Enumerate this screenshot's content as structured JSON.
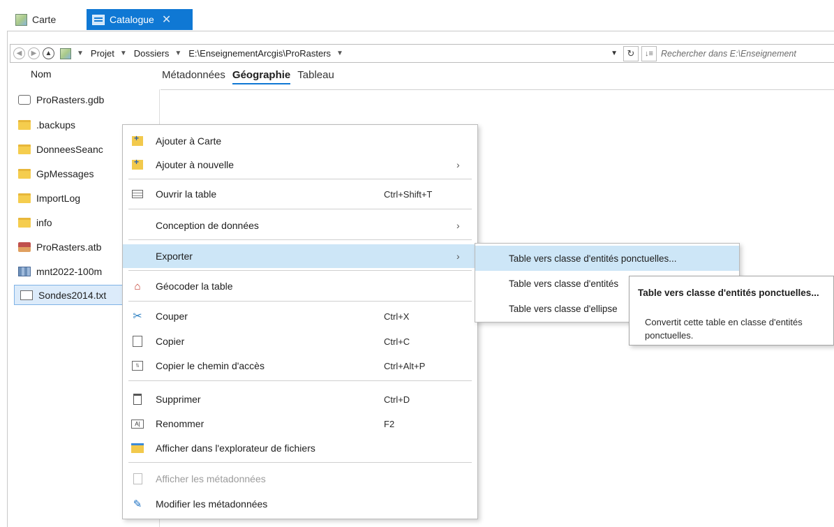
{
  "tabs": [
    {
      "label": "Carte",
      "icon": "map-icon"
    },
    {
      "label": "Catalogue",
      "icon": "catalog-icon",
      "active": true,
      "close": "✕"
    }
  ],
  "address": {
    "crumbs": [
      "Projet",
      "Dossiers",
      "E:\\EnseignementArcgis\\ProRasters"
    ],
    "search_placeholder": "Rechercher dans E:\\Enseignement"
  },
  "contents": {
    "header": "Nom",
    "items": [
      {
        "label": "ProRasters.gdb",
        "icon": "geodatabase-icon"
      },
      {
        "label": ".backups",
        "icon": "folder-icon"
      },
      {
        "label": "DonneesSeanc",
        "icon": "folder-icon"
      },
      {
        "label": "GpMessages",
        "icon": "folder-icon"
      },
      {
        "label": "ImportLog",
        "icon": "folder-icon"
      },
      {
        "label": "info",
        "icon": "folder-icon"
      },
      {
        "label": "ProRasters.atb",
        "icon": "toolbox-icon"
      },
      {
        "label": "mnt2022-100m",
        "icon": "raster-icon"
      },
      {
        "label": "Sondes2014.txt",
        "icon": "text-file-icon",
        "selected": true
      }
    ]
  },
  "view_tabs": [
    "Métadonnées",
    "Géographie",
    "Tableau"
  ],
  "context_menu": {
    "items": [
      {
        "label": "Ajouter à Carte",
        "shortcut": "",
        "submenu": false
      },
      {
        "label": "Ajouter à nouvelle",
        "shortcut": "",
        "submenu": true
      },
      {
        "label": "Ouvrir la table",
        "shortcut": "Ctrl+Shift+T",
        "submenu": false
      },
      {
        "label": "Conception de données",
        "shortcut": "",
        "submenu": true
      },
      {
        "label": "Exporter",
        "shortcut": "",
        "submenu": true,
        "highlighted": true
      },
      {
        "label": "Géocoder la table",
        "shortcut": "",
        "submenu": false
      },
      {
        "label": "Couper",
        "shortcut": "Ctrl+X",
        "submenu": false
      },
      {
        "label": "Copier",
        "shortcut": "Ctrl+C",
        "submenu": false
      },
      {
        "label": "Copier le chemin d'accès",
        "shortcut": "Ctrl+Alt+P",
        "submenu": false
      },
      {
        "label": "Supprimer",
        "shortcut": "Ctrl+D",
        "submenu": false
      },
      {
        "label": "Renommer",
        "shortcut": "F2",
        "submenu": false
      },
      {
        "label": "Afficher dans l'explorateur de fichiers",
        "shortcut": "",
        "submenu": false
      },
      {
        "label": "Afficher les métadonnées",
        "shortcut": "",
        "submenu": false,
        "disabled": true
      },
      {
        "label": "Modifier les métadonnées",
        "shortcut": "",
        "submenu": false
      }
    ],
    "arrow": "›"
  },
  "export_submenu": {
    "items": [
      {
        "label": "Table vers classe d'entités ponctuelles...",
        "highlighted": true
      },
      {
        "label": "Table vers classe d'entités"
      },
      {
        "label": "Table vers classe d'ellipse"
      }
    ]
  },
  "tooltip": {
    "title": "Table vers classe d'entités ponctuelles...",
    "description": "Convertit cette table en classe d'entités ponctuelles."
  },
  "colors": {
    "accent": "#0f78d4",
    "highlight": "#cde6f7",
    "selected_row": "#dcebfa"
  }
}
